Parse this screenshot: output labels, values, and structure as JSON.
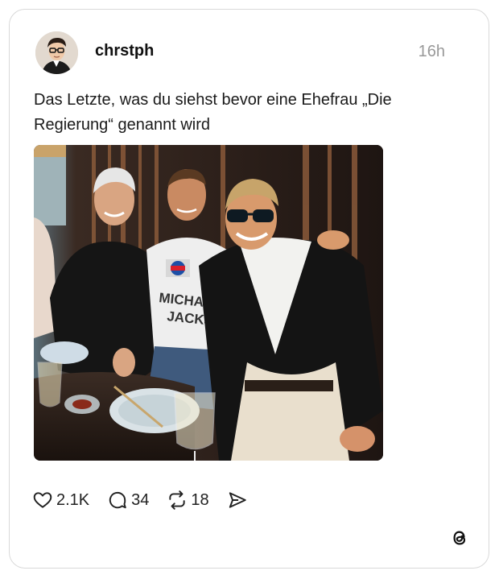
{
  "post": {
    "username": "chrstph",
    "time": "16h",
    "text": "Das Letzte, was du siehst bevor eine Ehefrau „Die Regierung“ genannt wird",
    "image_icon": "photo-three-men-at-dinner",
    "shirt_text_1": "MICHAEL",
    "shirt_text_2": "JACKSON"
  },
  "actions": {
    "likes": "2.1K",
    "replies": "34",
    "reposts": "18",
    "like_icon": "heart-icon",
    "reply_icon": "comment-icon",
    "repost_icon": "repost-icon",
    "share_icon": "send-icon"
  },
  "brand": {
    "logo_icon": "threads-logo-icon"
  },
  "colors": {
    "muted": "#999999",
    "border": "#d9d9d9",
    "text": "#111111"
  }
}
